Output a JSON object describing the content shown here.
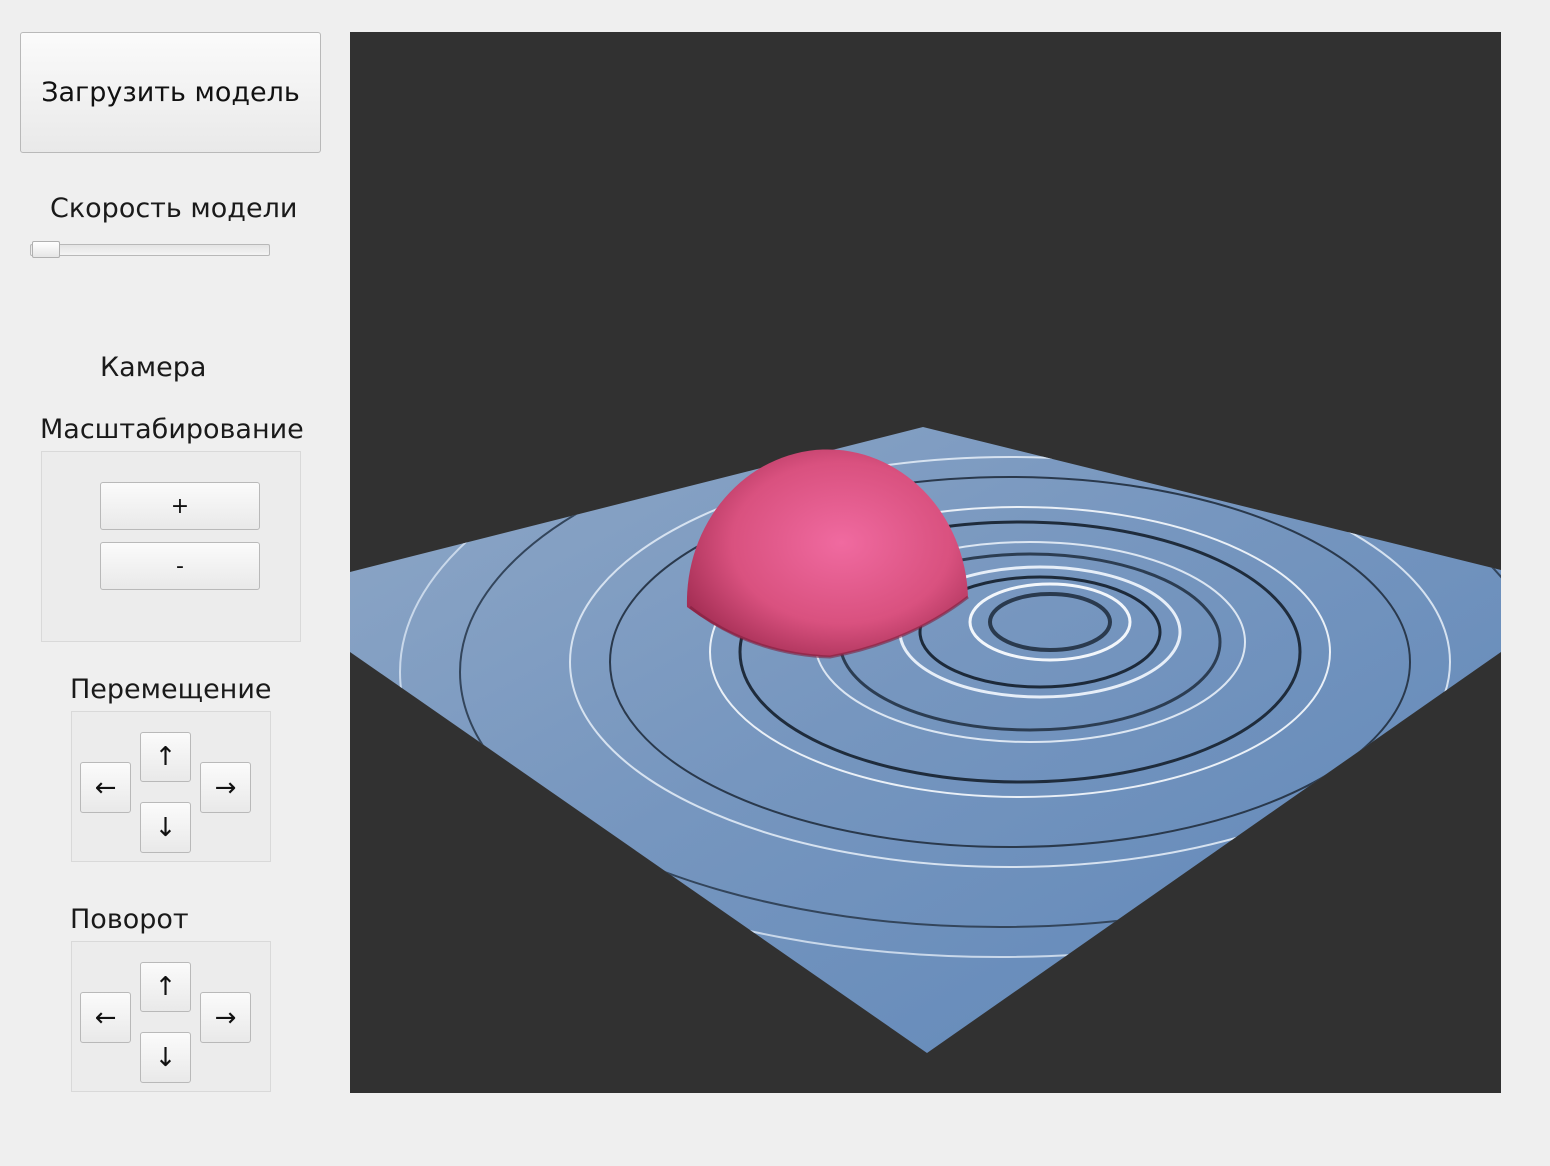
{
  "left_panel": {
    "load_model_button": "Загрузить модель",
    "speed_label": "Скорость модели",
    "speed_slider_value": 0,
    "camera_label": "Камера",
    "zoom": {
      "label": "Масштабирование",
      "plus": "+",
      "minus": "-"
    },
    "move": {
      "label": "Перемещение",
      "up": "↑",
      "down": "↓",
      "left": "←",
      "right": "→"
    },
    "rotate": {
      "label": "Поворот",
      "up": "↑",
      "down": "↓",
      "left": "←",
      "right": "→"
    }
  },
  "viewport": {
    "background_color": "#313131",
    "water_color": "#6f93bd",
    "sphere_color": "#e0578c",
    "icon": "3d-water-scene"
  }
}
